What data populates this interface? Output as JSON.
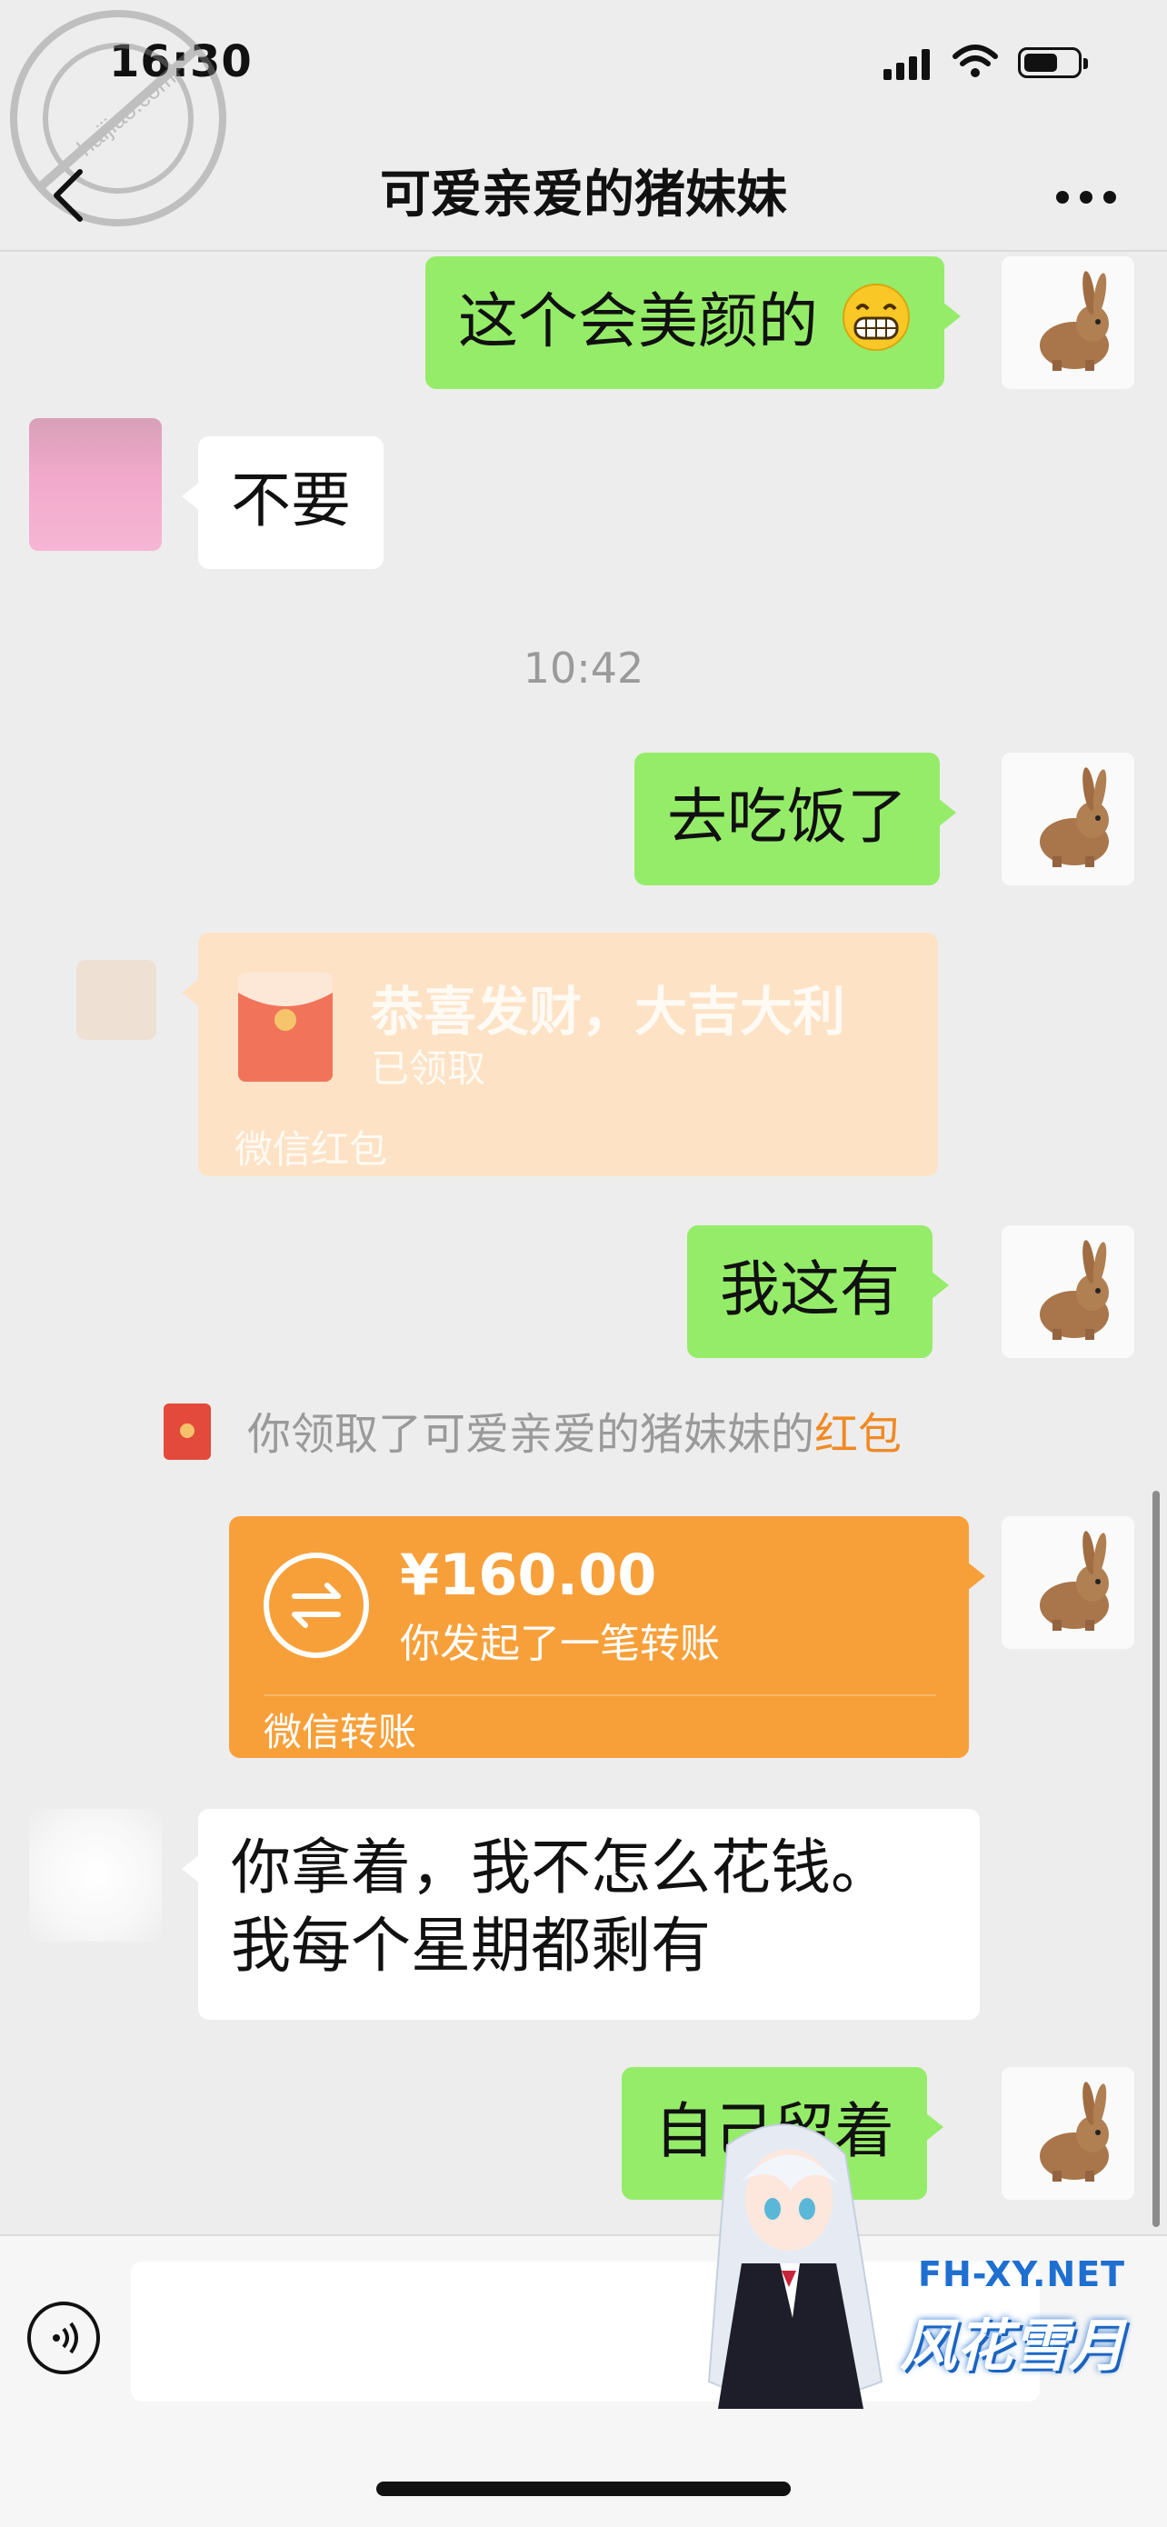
{
  "status_bar": {
    "time": "16:30"
  },
  "watermark": {
    "site": "haijiao.com",
    "name": "海角社区"
  },
  "nav": {
    "title": "可爱亲爱的猪妹妹"
  },
  "messages": [
    {
      "side": "out",
      "text": "这个会美颜的",
      "emoji": "grinning-emoji"
    },
    {
      "side": "in",
      "text": "不要"
    },
    {
      "side": "out",
      "text": "去吃饭了"
    },
    {
      "side": "out",
      "text": "我这有"
    },
    {
      "side": "in",
      "text_lines": [
        "你拿着，我不怎么花钱。",
        "我每个星期都剩有"
      ]
    },
    {
      "side": "out",
      "text": "自己留着"
    }
  ],
  "time_divider": "10:42",
  "red_packet": {
    "title": "恭喜发财，大吉大利",
    "status": "已领取",
    "footer": "微信红包",
    "color": "#fde2c6"
  },
  "system_notice": {
    "text": "你领取了可爱亲爱的猪妹妹的",
    "link": "红包"
  },
  "transfer": {
    "amount": "¥160.00",
    "description": "你发起了一笔转账",
    "footer": "微信转账",
    "color": "#f7a03a"
  },
  "input_bar": {
    "placeholder": ""
  },
  "mascot": {
    "site": "FH-XY.NET",
    "brand": "风花雪月"
  },
  "colors": {
    "outgoing_bubble": "#95ec69",
    "incoming_bubble": "#ffffff",
    "background": "#ededed",
    "link": "#f08a25"
  }
}
